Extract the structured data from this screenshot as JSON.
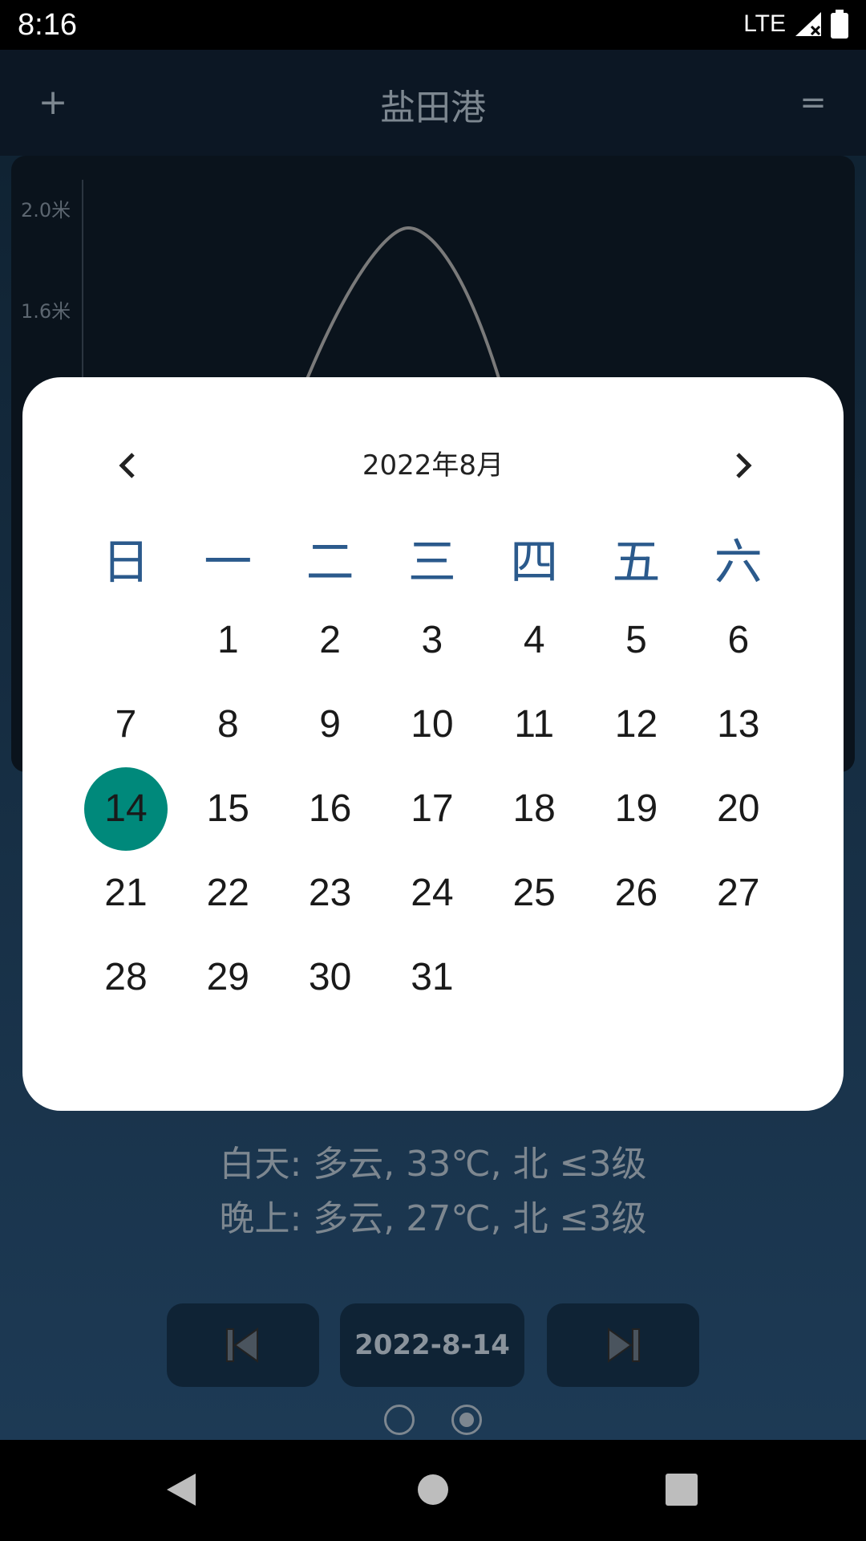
{
  "status": {
    "time": "8:16",
    "network": "LTE"
  },
  "app": {
    "title": "盐田港",
    "add_label": "+",
    "menu_label": "="
  },
  "chart": {
    "y_ticks": [
      "2.0米",
      "1.6米"
    ]
  },
  "weather": {
    "day": "白天: 多云, 33℃, 北 ≤3级",
    "night": "晚上: 多云, 27℃, 北 ≤3级"
  },
  "navigation": {
    "date": "2022-8-14",
    "page_count": 2,
    "active_page": 2
  },
  "calendar": {
    "title": "2022年8月",
    "weekdays": [
      "日",
      "一",
      "二",
      "三",
      "四",
      "五",
      "六"
    ],
    "weeks": [
      [
        "",
        "1",
        "2",
        "3",
        "4",
        "5",
        "6"
      ],
      [
        "7",
        "8",
        "9",
        "10",
        "11",
        "12",
        "13"
      ],
      [
        "14",
        "15",
        "16",
        "17",
        "18",
        "19",
        "20"
      ],
      [
        "21",
        "22",
        "23",
        "24",
        "25",
        "26",
        "27"
      ],
      [
        "28",
        "29",
        "30",
        "31",
        "",
        "",
        ""
      ]
    ],
    "selected_day": "14",
    "selected_color": "#00897b",
    "weekday_color": "#2b5a8c"
  }
}
